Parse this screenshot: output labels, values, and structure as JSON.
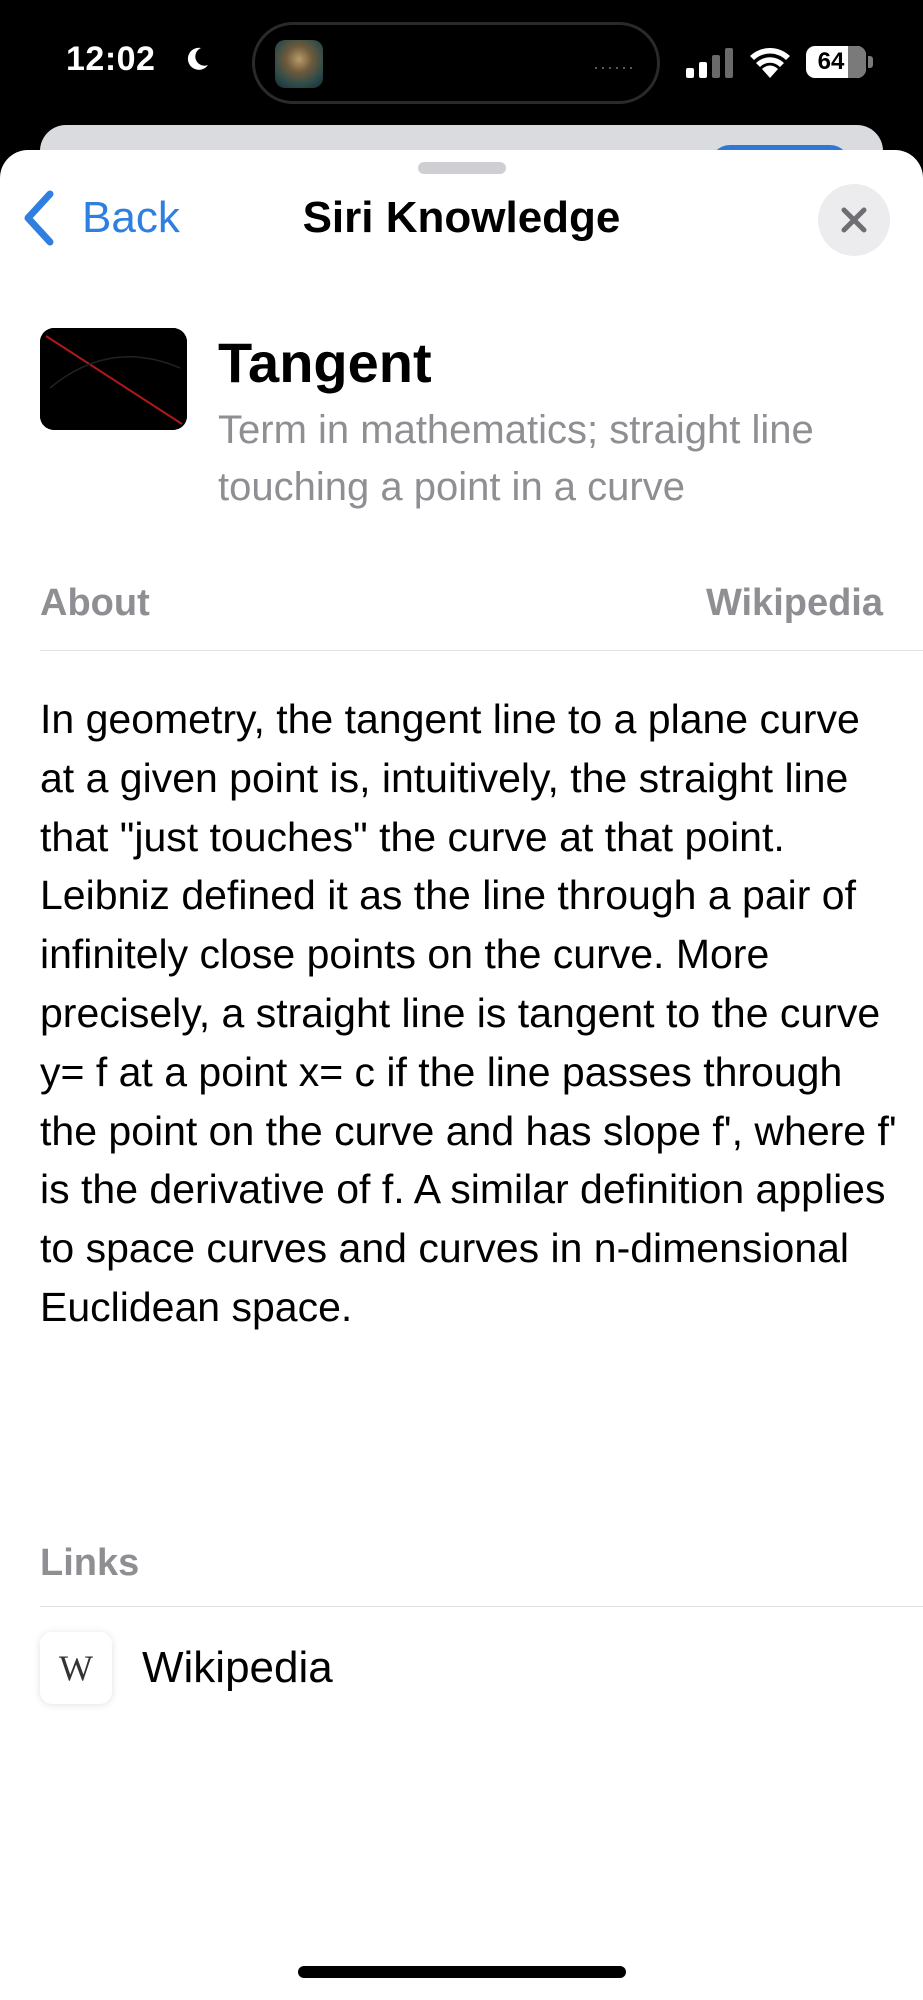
{
  "status_bar": {
    "time": "12:02",
    "battery": "64",
    "icons": [
      "moon-icon",
      "signal-icon",
      "wifi-icon",
      "battery-icon"
    ]
  },
  "nav": {
    "back_label": "Back",
    "title": "Siri Knowledge",
    "close_icon": "close-icon"
  },
  "entity": {
    "title": "Tangent",
    "subtitle": "Term in mathematics; straight line touching a point in a curve"
  },
  "about": {
    "label": "About",
    "source": "Wikipedia",
    "text": "In geometry, the tangent line to a plane curve at a given point is, intuitively, the straight line that \"just touches\" the curve at that point. Leibniz defined it as the line through a pair of infinitely close points on the curve. More precisely, a straight line is tangent to the curve y= f at a point x= c if the line passes through the point on the curve and has slope f', where f' is the derivative of f. A similar definition applies to space curves and curves in n-dimensional Euclidean space."
  },
  "links": {
    "label": "Links",
    "items": [
      {
        "icon_text": "W",
        "label": "Wikipedia"
      }
    ]
  },
  "colors": {
    "accent": "#2f7fe0",
    "secondary_text": "#8e8e93",
    "sheet_bg": "#ffffff"
  }
}
